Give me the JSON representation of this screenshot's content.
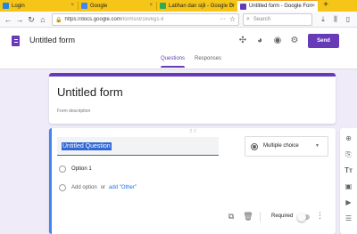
{
  "browser": {
    "tabs": [
      {
        "label": "Login",
        "favicon_color": "#1e88e5",
        "active": false
      },
      {
        "label": "Google",
        "favicon_color": "#4285f4",
        "active": false
      },
      {
        "label": "Latihan dan sijil - Google Dr",
        "favicon_color": "#34a853",
        "active": false
      },
      {
        "label": "Untitled form - Google Forr",
        "favicon_color": "#673ab7",
        "active": true
      }
    ],
    "close_glyph": "×",
    "new_tab_glyph": "+",
    "window_buttons": {
      "minimize": "—",
      "maximize": "☐",
      "close": "✕"
    },
    "url_host": "https://docs.google.com",
    "url_path": "/forms/d/1kv6g1-ll",
    "search_placeholder": "Search"
  },
  "forms": {
    "doc_title": "Untitled form",
    "send_label": "Send",
    "tabs": [
      {
        "label": "Questions",
        "active": true
      },
      {
        "label": "Responses",
        "active": false
      }
    ]
  },
  "title_card": {
    "title": "Untitled form",
    "description": "Form description"
  },
  "question": {
    "title": "Untitled Question",
    "type": "Multiple choice",
    "options": [
      "Option 1"
    ],
    "add_option": "Add option",
    "or": "or",
    "add_other": "add \"Other\"",
    "required_label": "Required",
    "required": false
  },
  "colors": {
    "accent": "#673ab7",
    "tabbar": "#f5c518",
    "link": "#1a73e8",
    "selection": "#3367d6",
    "question_edge": "#4285f4"
  }
}
